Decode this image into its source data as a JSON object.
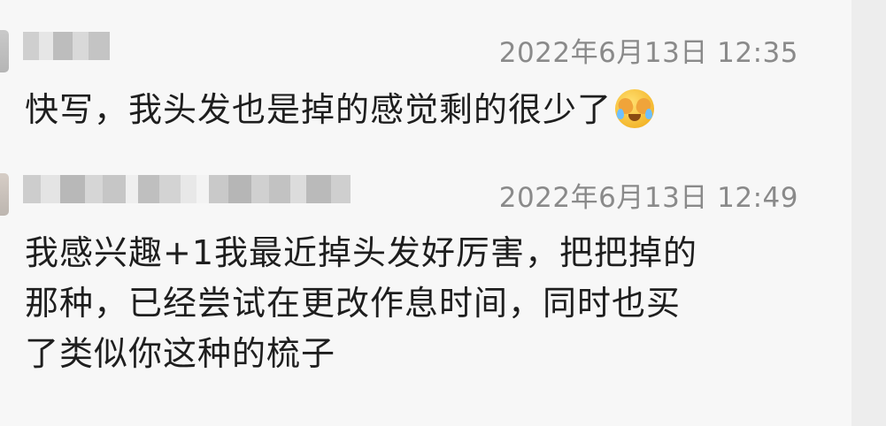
{
  "comments": [
    {
      "author_redacted": true,
      "timestamp": "2022年6月13日 12:35",
      "text": "快写，我头发也是掉的感觉剩的很少了",
      "emoji": "face-with-tears-covering-eyes-icon"
    },
    {
      "author_redacted": true,
      "timestamp": "2022年6月13日 12:49",
      "text_lines": [
        "我感兴趣+1我最近掉头发好厉害，把把掉的",
        "那种，已经尝试在更改作息时间，同时也买",
        "了类似你这种的梳子"
      ]
    }
  ],
  "colors": {
    "background": "#f7f7f7",
    "timestamp": "#8a8a8a",
    "text": "#1e1e1e"
  }
}
